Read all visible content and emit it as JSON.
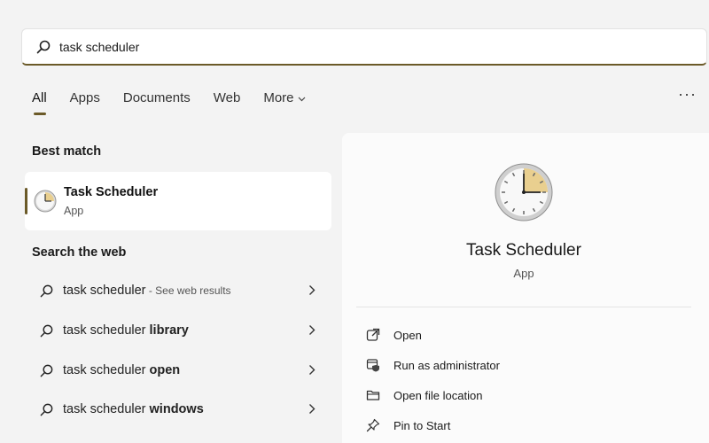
{
  "search": {
    "value": "task scheduler",
    "icon": "search-icon"
  },
  "tabs": [
    {
      "label": "All",
      "active": true
    },
    {
      "label": "Apps"
    },
    {
      "label": "Documents"
    },
    {
      "label": "Web"
    },
    {
      "label": "More"
    }
  ],
  "more_menu": "···",
  "best_match": {
    "title": "Best match",
    "item": {
      "name": "Task Scheduler",
      "kind": "App"
    }
  },
  "search_web": {
    "title": "Search the web",
    "items": [
      {
        "prefix": "task scheduler",
        "bold": "",
        "suffix": " - See web results"
      },
      {
        "prefix": "task scheduler ",
        "bold": "library",
        "suffix": ""
      },
      {
        "prefix": "task scheduler ",
        "bold": "open",
        "suffix": ""
      },
      {
        "prefix": "task scheduler ",
        "bold": "windows",
        "suffix": ""
      }
    ]
  },
  "preview": {
    "name": "Task Scheduler",
    "kind": "App",
    "actions": [
      {
        "label": "Open",
        "icon": "open-external-icon"
      },
      {
        "label": "Run as administrator",
        "icon": "shield-admin-icon"
      },
      {
        "label": "Open file location",
        "icon": "folder-icon"
      },
      {
        "label": "Pin to Start",
        "icon": "pin-icon"
      }
    ]
  },
  "colors": {
    "accent": "#6b5a28",
    "background": "#f3f3f3",
    "card": "#ffffff",
    "clock_fill": "#e9cf8f"
  }
}
